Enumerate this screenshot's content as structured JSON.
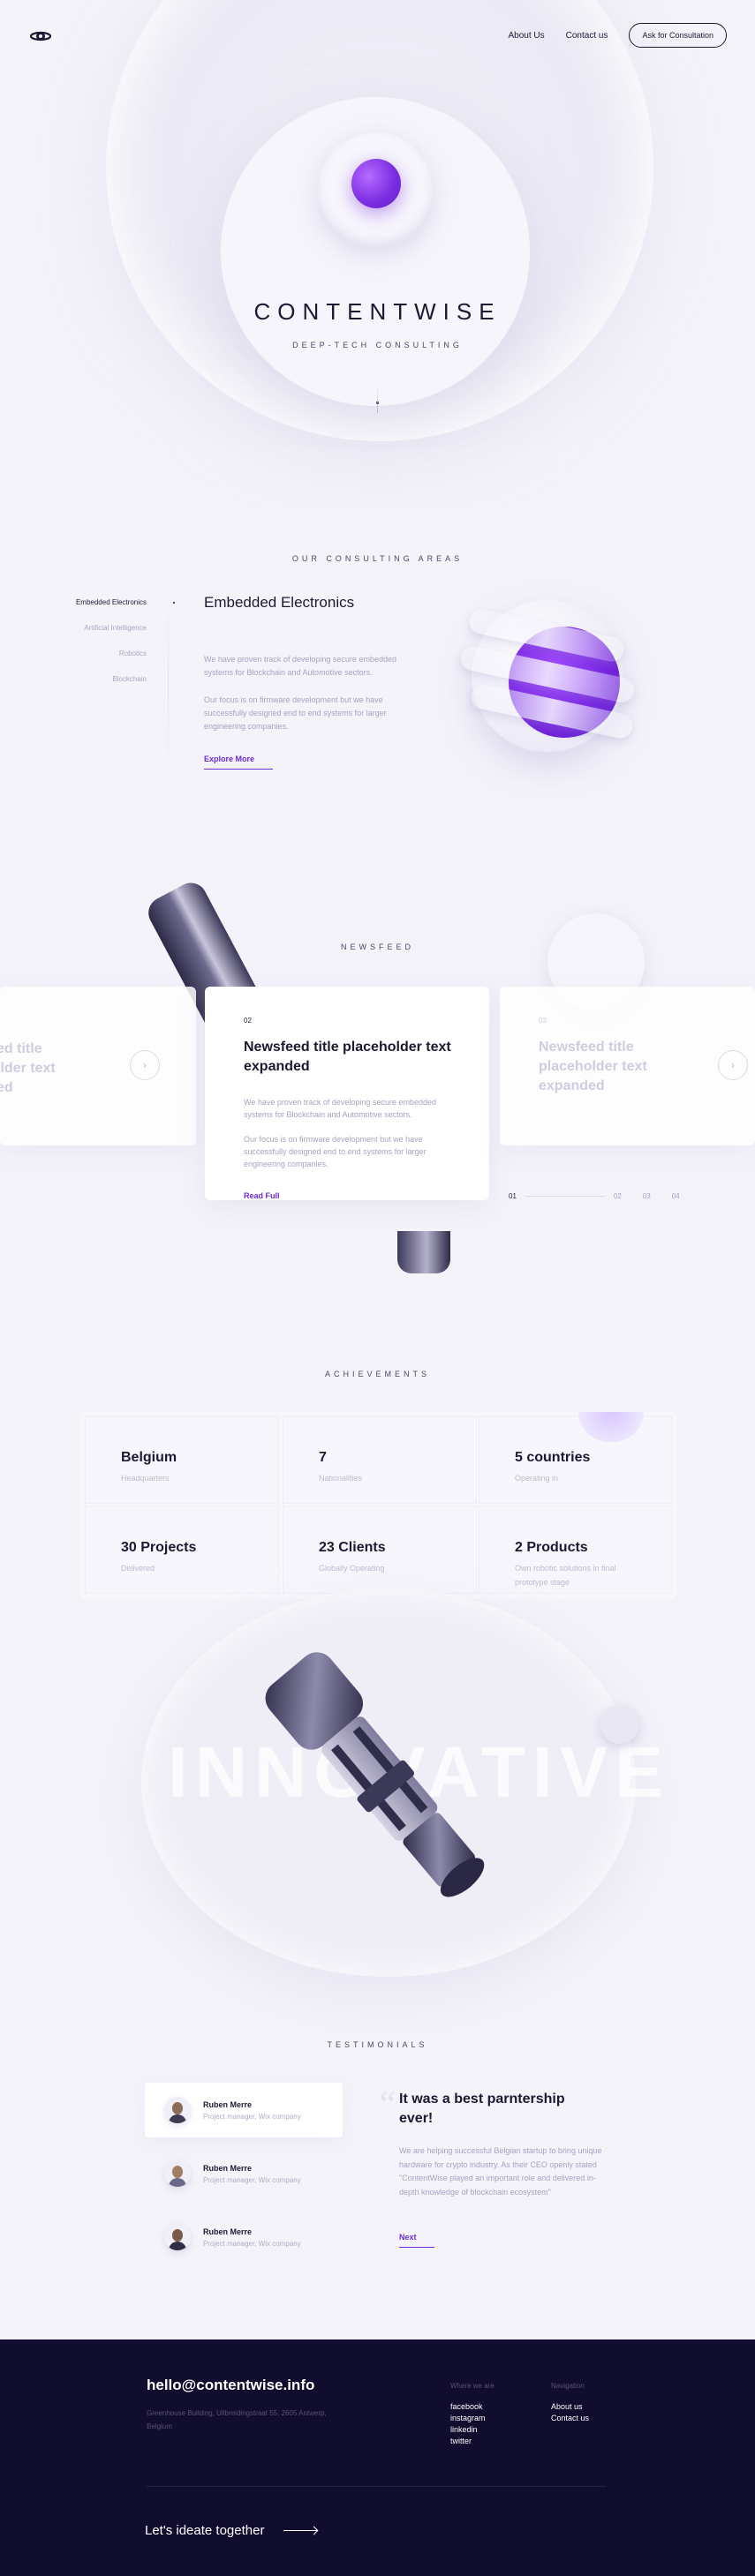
{
  "header": {
    "nav": [
      "About Us",
      "Contact us"
    ],
    "cta": "Ask for Consultation",
    "logo_icon": "contentwise-logo-icon"
  },
  "hero": {
    "title": "CONTENTWISE",
    "subtitle": "DEEP-TECH CONSULTING",
    "accent": "#7a2be0"
  },
  "consulting": {
    "label": "OUR CONSULTING AREAS",
    "areas": [
      "Embedded Electronics",
      "Artificial Intelligence",
      "Robotics",
      "Blockchain"
    ],
    "active_index": 0,
    "title": "Embedded Electronics",
    "paragraph1": "We have proven track of developing secure embedded systems for Blockchain and Automotive sectors.",
    "paragraph2": "Our focus is on firmware development but we have successfully designed end to end systems for larger engineering companies.",
    "link": "Explore More"
  },
  "newsfeed": {
    "label": "NEWSFEED",
    "prev_card": {
      "title": "Newsfeed title placeholder text expanded"
    },
    "active_card": {
      "number": "02",
      "title": "Newsfeed title placeholder text expanded",
      "paragraph1": "We have proven track of developing secure embedded systems for Blockchain and Automotive sectors.",
      "paragraph2": "Our focus is on firmware development but we have successfully designed end to end systems for larger engineering companies.",
      "link": "Read Full"
    },
    "next_card": {
      "number": "03",
      "title": "Newsfeed title placeholder text expanded"
    },
    "pager": [
      "01",
      "02",
      "03",
      "04"
    ],
    "arrow_icon": "arrow-right-icon"
  },
  "achievements": {
    "label": "ACHIEVEMENTS",
    "items": [
      {
        "value": "Belgium",
        "label": "Headquarters"
      },
      {
        "value": "7",
        "label": "Nationalities"
      },
      {
        "value": "5 countries",
        "label": "Operating in"
      },
      {
        "value": "30 Projects",
        "label": "Delivered"
      },
      {
        "value": "23 Clients",
        "label": "Globally Operating"
      },
      {
        "value": "2 Products",
        "label": "Own robotic solutions in final prototype stage"
      }
    ]
  },
  "innovative": {
    "text": "INNOVATIVE"
  },
  "testimonials": {
    "label": "TESTIMONIALS",
    "people": [
      {
        "name": "Ruben Merre",
        "role": "Project manager, Wix company"
      },
      {
        "name": "Ruben Merre",
        "role": "Project manager, Wix company"
      },
      {
        "name": "Ruben Merre",
        "role": "Project manager, Wix company"
      }
    ],
    "quote_mark": "“",
    "title": "It was a best parntership ever!",
    "body": "We are helping successful Belgian startup to bring unique hardware for crypto industry. As their CEO openly stated \"ContentWise played an important role and delivered in-depth knowledge of blockchain ecosystem\"",
    "link": "Next"
  },
  "footer": {
    "email": "hello@contentwise.info",
    "address": "Greenhouse Building, Ullbreidingstraat 55, 2605 Antwerp, Belgium",
    "col1": {
      "heading": "Where we are",
      "links": [
        "facebook",
        "instagram",
        "linkedin",
        "twitter"
      ]
    },
    "col2": {
      "heading": "Navigation",
      "links": [
        "About us",
        "Contact us"
      ]
    },
    "cta": "Let's ideate together",
    "bg": "#100d2e"
  }
}
